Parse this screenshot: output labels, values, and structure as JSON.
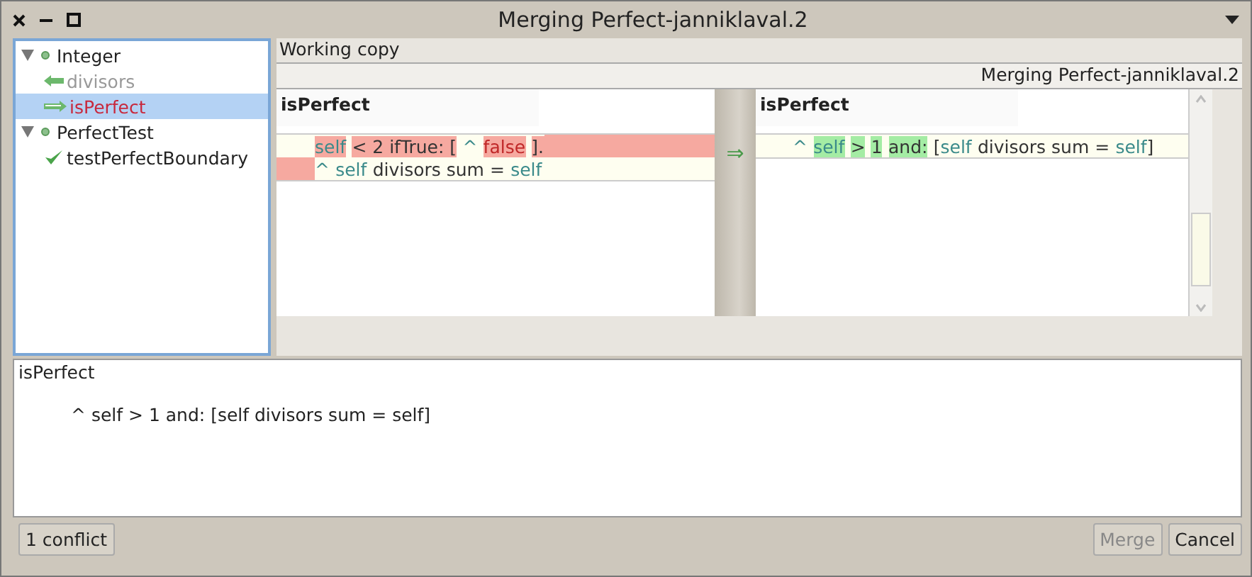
{
  "window": {
    "title": "Merging Perfect-janniklaval.2"
  },
  "tree": [
    {
      "label": "Integer",
      "expanded": true,
      "children": [
        {
          "label": "divisors",
          "kind": "incoming",
          "selected": false,
          "disabled": true
        },
        {
          "label": "isPerfect",
          "kind": "outgoing",
          "selected": true,
          "disabled": false
        }
      ]
    },
    {
      "label": "PerfectTest",
      "expanded": true,
      "children": [
        {
          "label": "testPerfectBoundary",
          "kind": "test",
          "selected": false,
          "disabled": false
        }
      ]
    }
  ],
  "left_pane": {
    "header": "Working copy",
    "method": "isPerfect",
    "lines": [
      {
        "marked": false,
        "fill": true,
        "segments": [
          {
            "text": "self",
            "kind": "var",
            "changed": true
          },
          {
            "text": "< 2 ifTrue: [",
            "kind": "plain",
            "changed": true
          },
          {
            "text": "^",
            "kind": "var",
            "changed": false
          },
          {
            "text": "false",
            "kind": "lit",
            "changed": true
          },
          {
            "text": "].",
            "kind": "plain",
            "changed": true
          }
        ]
      },
      {
        "marked": true,
        "fill": false,
        "segments": [
          {
            "text": "^",
            "kind": "var",
            "changed": false
          },
          {
            "text": "self",
            "kind": "var",
            "changed": false
          },
          {
            "text": "divisors sum =",
            "kind": "plain",
            "changed": false
          },
          {
            "text": "self",
            "kind": "var",
            "changed": false
          }
        ]
      }
    ]
  },
  "gutter": {
    "arrow": "⇒"
  },
  "right_pane": {
    "header": "Merging Perfect-janniklaval.2",
    "method": "isPerfect",
    "lines": [
      {
        "segments": [
          {
            "text": "^",
            "kind": "var",
            "changed": false
          },
          {
            "text": "self",
            "kind": "var",
            "changed": true
          },
          {
            "text": ">",
            "kind": "plain",
            "changed": true
          },
          {
            "text": "1",
            "kind": "plain",
            "changed": true
          },
          {
            "text": "and:",
            "kind": "plain",
            "changed": true
          },
          {
            "text": "[",
            "kind": "plain",
            "changed": false
          },
          {
            "text": "self",
            "kind": "var",
            "changed": false,
            "glue": true
          },
          {
            "text": "divisors sum =",
            "kind": "plain",
            "changed": false
          },
          {
            "text": "self",
            "kind": "var",
            "changed": false
          },
          {
            "text": "]",
            "kind": "plain",
            "changed": false,
            "glue": true
          }
        ]
      }
    ]
  },
  "result": {
    "method": "isPerfect",
    "code": "^ self > 1 and: [self divisors sum = self]"
  },
  "footer": {
    "status": "1 conflict",
    "buttons": [
      {
        "label": "Merge",
        "disabled": true
      },
      {
        "label": "Cancel",
        "disabled": false
      }
    ]
  }
}
